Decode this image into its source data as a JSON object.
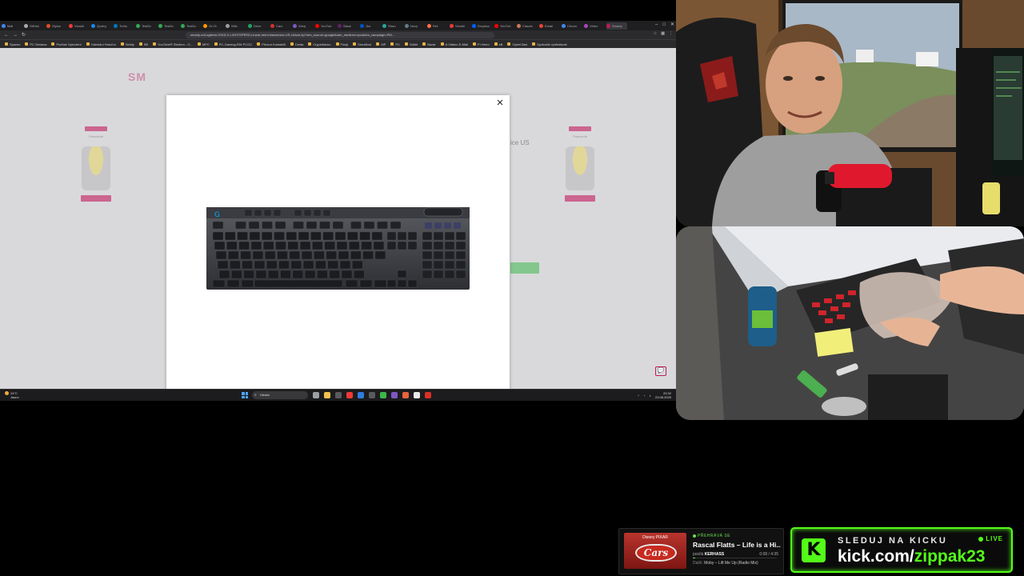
{
  "browser": {
    "tabs": [
      "Mail",
      "GitHub",
      "Stylus",
      "Vivaldi",
      "Zprávy",
      "Trello",
      "TestDo",
      "TestDo",
      "TestDo",
      "Gr.Ch",
      "Wiki",
      "Drive",
      "Cars",
      "Zdroj",
      "YouTub",
      "Slack",
      "Jira",
      "Stran",
      "Nový",
      "Ref.",
      "Vivaldi",
      "Dropbox",
      "YouTub",
      "Claude",
      "Email",
      "Chrom",
      "Video",
      "Smarty"
    ],
    "tab_colors": [
      "#4285f4",
      "#aaaaaa",
      "#e34c26",
      "#ef3939",
      "#1e88e5",
      "#0079bf",
      "#34a853",
      "#34a853",
      "#34a853",
      "#ff9800",
      "#9e9e9e",
      "#1fa463",
      "#d32f2f",
      "#7e57c2",
      "#ff0000",
      "#611f69",
      "#0052cc",
      "#26a69a",
      "#607d8b",
      "#ff7043",
      "#ef3939",
      "#0061fe",
      "#ff0000",
      "#cc785c",
      "#ea4335",
      "#4285f4",
      "#ab47bc",
      "#c2185b"
    ],
    "url": "smarty.cz/Logitech-G915-X-LIGHTSPEED-Linear-herni-klavesnice-US-Uzivat-4p?utm_source=google&utm_medium=cpc&utm_campaign=PM...",
    "bookmarks": [
      "Spaces",
      "PC Sestava",
      "Počítač Vytvoření",
      "Odeslání Hracího",
      "Sešity",
      "SB",
      "YouTube® Sterben - G...",
      "MPC",
      "PC-Gaming-RW PCGC",
      "Přesun Kontaktů",
      "Cesta",
      "Cryptoflacko",
      "Finuji",
      "Senzitivní",
      "MP",
      "PC",
      "Sdílet",
      "Bazar",
      "A Vlákno E-Mail",
      "Pí Herní",
      "eB",
      "OpenClaw",
      "Spolužák vyhledávač"
    ]
  },
  "webpage": {
    "logo_text": "SM",
    "right_title": "ice US",
    "side_badge_text": "Pomocník"
  },
  "modal": {
    "close_symbol": "×"
  },
  "taskbar": {
    "weather_temp": "24°C",
    "weather_desc": "Jasno",
    "search_placeholder": "Hledat",
    "time": "20:32",
    "date": "23.08.2025"
  },
  "now_playing": {
    "status": "PŘEHRÁVÁ SE",
    "title": "Rascal Flatts – Life is a Hi...",
    "added_by_label": "posílá",
    "added_by": "KERHASS",
    "time": "0:08 / 4:35",
    "progress": 0.03,
    "next_label": "Další:",
    "next_track": "Moby – Lift Me Up (Radio Mix)",
    "album_top": "Disney PIXAR",
    "album_logo": "Cars"
  },
  "kick": {
    "logo_letter": "K",
    "line1": "SLEDUJ NA KICKU",
    "line2_prefix": "kick.com/",
    "line2_user": "zippak23",
    "live": "LIVE",
    "accent": "#53fc18"
  }
}
